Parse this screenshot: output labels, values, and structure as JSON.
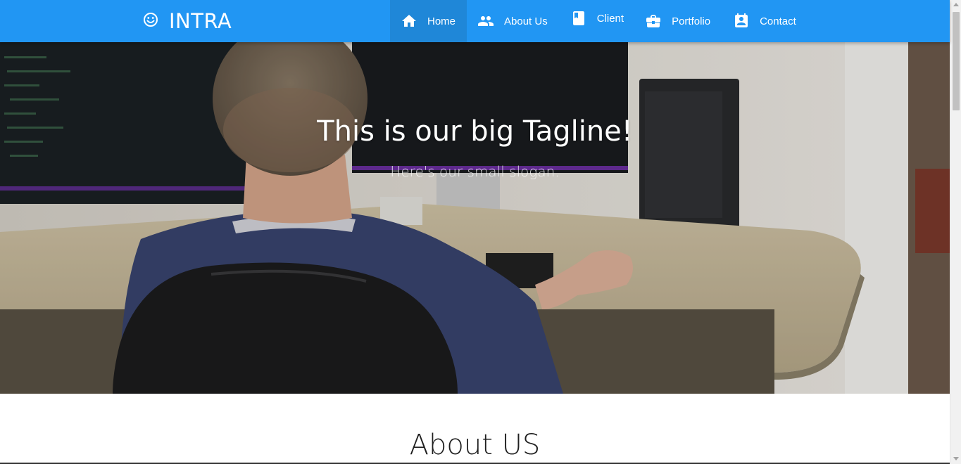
{
  "brand": {
    "name": "INTRA",
    "icon": "smiley-icon"
  },
  "nav": {
    "items": [
      {
        "label": "Home",
        "icon": "home-icon",
        "active": true
      },
      {
        "label": "About Us",
        "icon": "people-icon",
        "active": false
      },
      {
        "label": "Client",
        "icon": "book-icon",
        "active": false
      },
      {
        "label": "Portfolio",
        "icon": "briefcase-icon",
        "active": false
      },
      {
        "label": "Contact",
        "icon": "contact-card-icon",
        "active": false
      }
    ]
  },
  "hero": {
    "title": "This is our big Tagline!",
    "slogan": "Here's our small slogan."
  },
  "about": {
    "heading": "About US"
  },
  "colors": {
    "navbar": "#2196f3",
    "nav_active": "#1f87d8",
    "text_light": "#ffffff",
    "heading_dark": "#1f1f1f"
  }
}
